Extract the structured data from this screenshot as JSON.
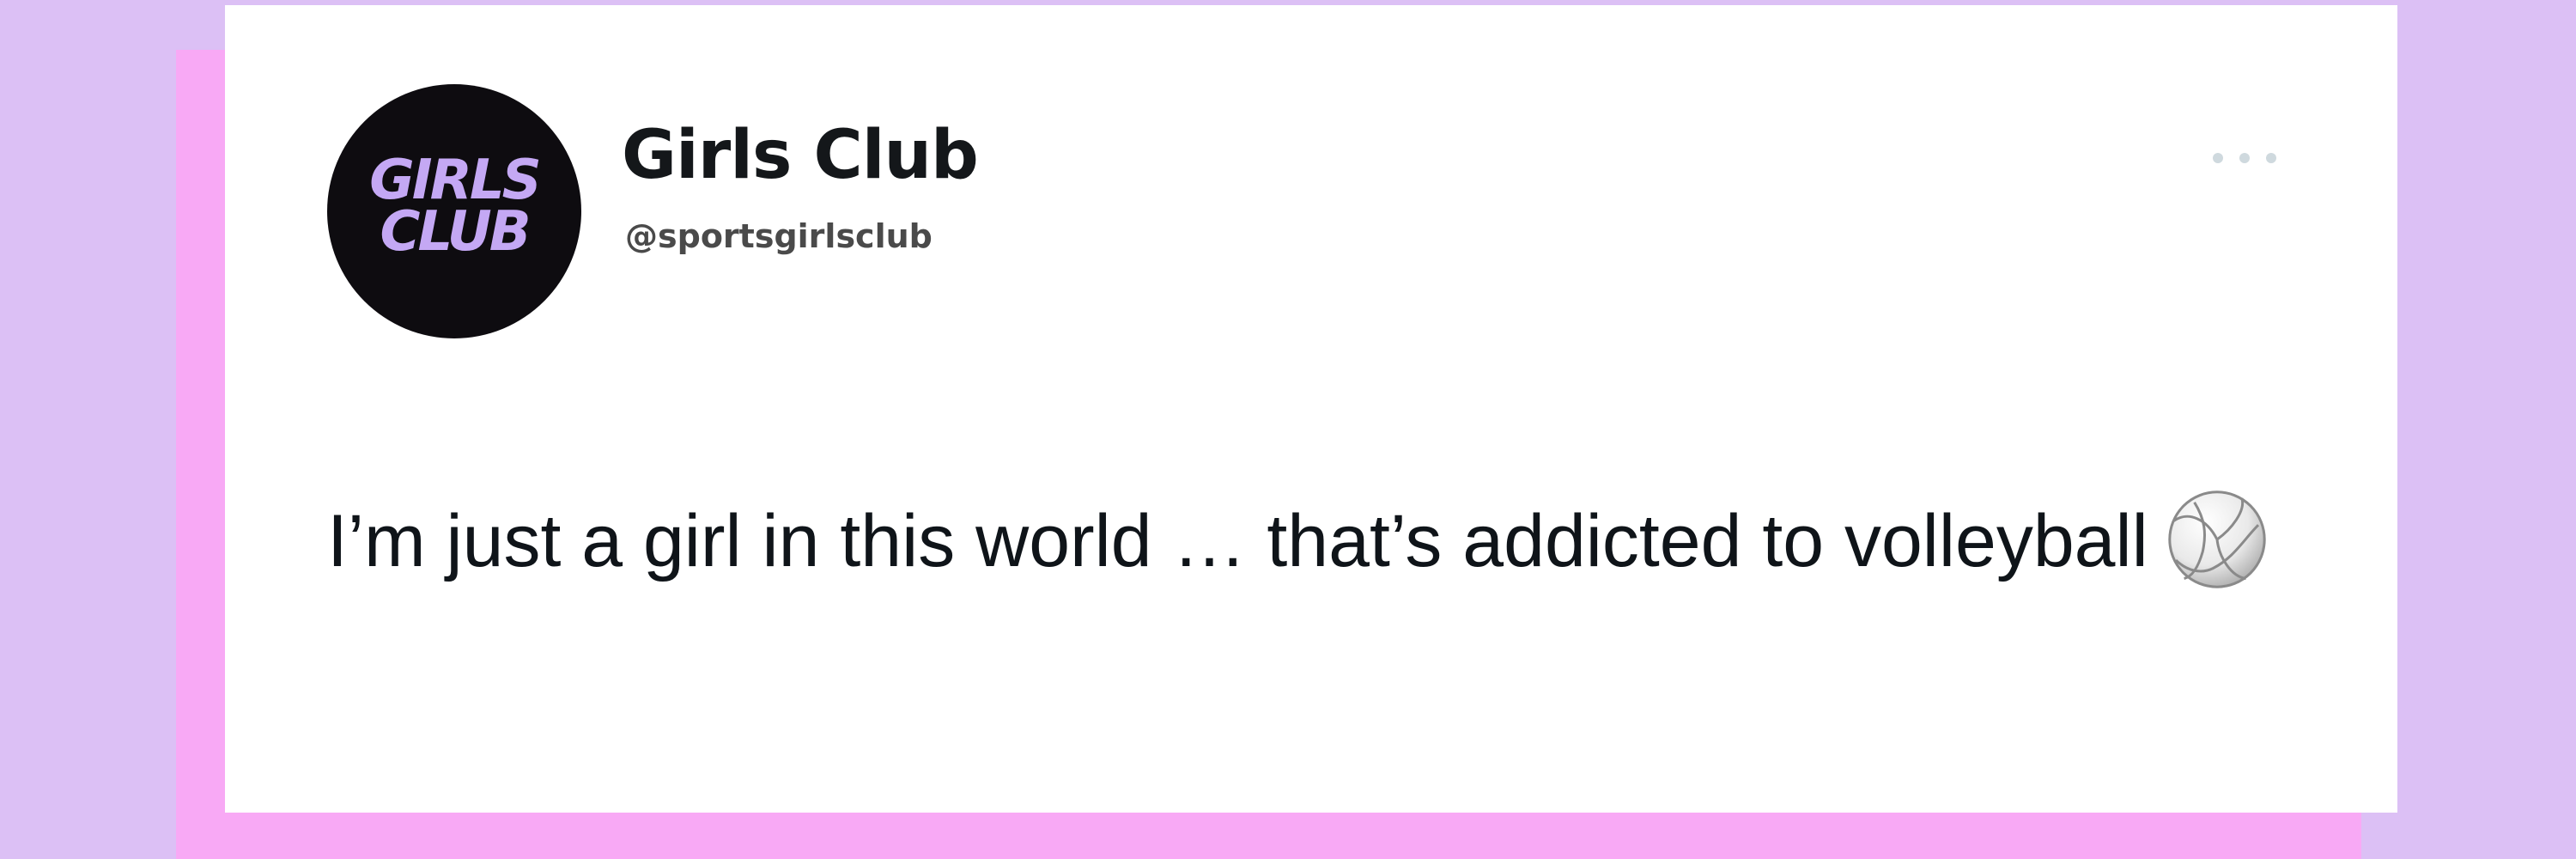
{
  "colors": {
    "page_background": "#dcc0f5",
    "accent_pink": "#f8a9f5",
    "card_background": "#ffffff",
    "avatar_background": "#0e0c10",
    "avatar_text": "#c4a8f4",
    "text_primary": "#0f1419",
    "text_secondary": "#4a4a4a",
    "more_icon": "#cfd9de"
  },
  "tweet": {
    "avatar": {
      "line1": "GIRLS",
      "line2": "CLUB"
    },
    "display_name": "Girls Club",
    "handle": "@sportsgirlsclub",
    "more_icon": "more-horizontal-icon",
    "text": "I’m just a girl in this world … that’s addicted to volleyball",
    "emoji": "volleyball-icon"
  }
}
